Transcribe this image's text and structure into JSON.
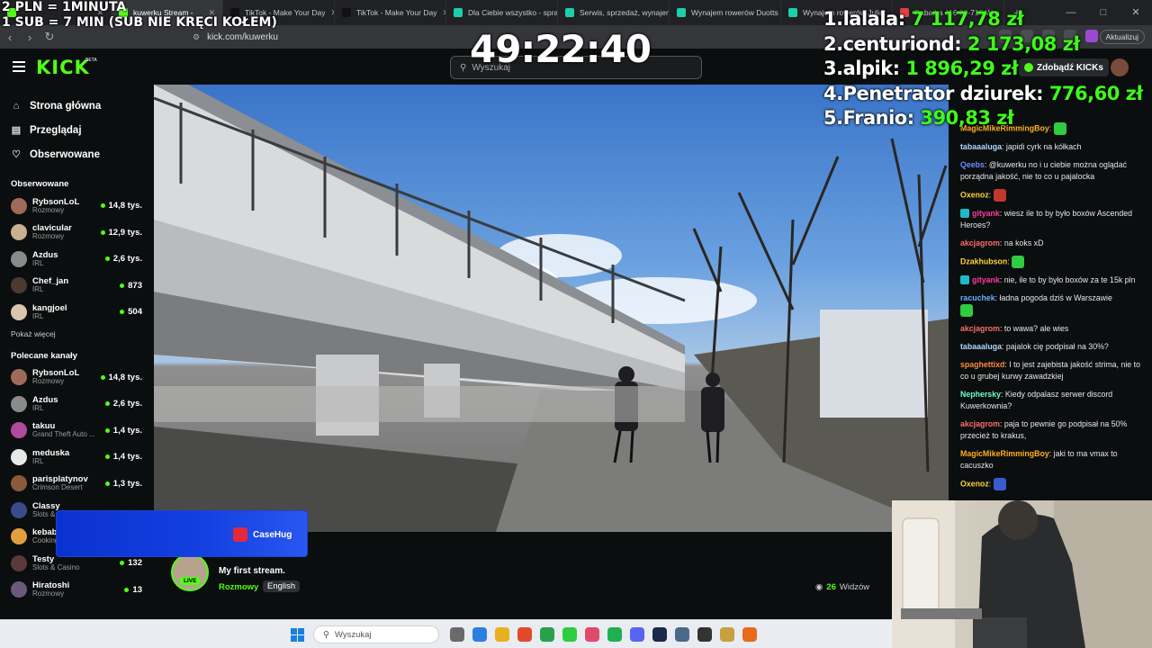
{
  "browser": {
    "tabs": [
      {
        "label": "",
        "color": "#53fc18"
      },
      {
        "label": "kuwerku Stream - ",
        "color": "#53fc18",
        "active": true
      },
      {
        "label": "TikTok - Make Your Day",
        "color": "#111111"
      },
      {
        "label": "TikTok - Make Your Day",
        "color": "#111111"
      },
      {
        "label": "Dla Ciebie wszystko - spra",
        "color": "#1ccfa8"
      },
      {
        "label": "Serwis, sprzedaż, wynajem",
        "color": "#1ccfa8"
      },
      {
        "label": "Wynajem rowerów Duotts",
        "color": "#1ccfa8"
      },
      {
        "label": "Wynajem rowerów Juliet",
        "color": "#1ccfa8"
      },
      {
        "label": "Rabatka 116 00-715 War",
        "color": "#e04040"
      }
    ],
    "url": "kick.com/kuwerku",
    "update_label": "Aktualizuj"
  },
  "header": {
    "logo": "KICK",
    "beta": "BETA",
    "search_placeholder": "Wyszukaj",
    "get_kicks": "Zdobądź KICKs"
  },
  "sidebar": {
    "nav": [
      {
        "label": "Strona główna",
        "icon": "home-icon"
      },
      {
        "label": "Przeglądaj",
        "icon": "browse-icon"
      },
      {
        "label": "Obserwowane",
        "icon": "heart-icon"
      }
    ],
    "followed_title": "Obserwowane",
    "followed": [
      {
        "name": "RybsonLoL",
        "category": "Rozmowy",
        "viewers": "14,8 tys.",
        "color": "#a06a5a"
      },
      {
        "name": "clavicular",
        "category": "Rozmowy",
        "viewers": "12,9 tys.",
        "color": "#c8b090"
      },
      {
        "name": "Azdus",
        "category": "IRL",
        "viewers": "2,6 tys.",
        "color": "#8a8a8a"
      },
      {
        "name": "Chef_jan",
        "category": "IRL",
        "viewers": "873",
        "color": "#4a3a30"
      },
      {
        "name": "kangjoel",
        "category": "IRL",
        "viewers": "504",
        "color": "#d9c4b0"
      }
    ],
    "show_more": "Pokaż więcej",
    "recommended_title": "Polecane kanały",
    "recommended": [
      {
        "name": "RybsonLoL",
        "category": "Rozmowy",
        "viewers": "14,8 tys.",
        "color": "#a06a5a"
      },
      {
        "name": "Azdus",
        "category": "IRL",
        "viewers": "2,6 tys.",
        "color": "#8a8a8a"
      },
      {
        "name": "takuu",
        "category": "Grand Theft Auto ...",
        "viewers": "1,4 tys.",
        "color": "#b04a9a"
      },
      {
        "name": "meduska",
        "category": "IRL",
        "viewers": "1,4 tys.",
        "color": "#e8e8e8"
      },
      {
        "name": "parisplatynov",
        "category": "Crimson Desert",
        "viewers": "1,3 tys.",
        "color": "#8a5a3a"
      },
      {
        "name": "Classy",
        "category": "Slots & ...",
        "viewers": "",
        "color": "#3a4a8a"
      },
      {
        "name": "kebab",
        "category": "Cooking",
        "viewers": "",
        "color": "#e0a040"
      },
      {
        "name": "Testy",
        "category": "Slots & Casino",
        "viewers": "132",
        "color": "#5a3a3a"
      },
      {
        "name": "Hiratoshi",
        "category": "Rozmowy",
        "viewers": "13",
        "color": "#6a5a7a"
      }
    ]
  },
  "stream": {
    "title": "My first stream.",
    "category": "Rozmowy",
    "language": "English",
    "live": "LIVE",
    "viewers_count": "26",
    "viewers_label": "Widzów"
  },
  "chat": [
    {
      "user": "MagicMikeRimmingBoy",
      "color": "#ffb020",
      "text": "",
      "emote": "#2ecc40"
    },
    {
      "user": "tabaaaluga",
      "color": "#b0d8ff",
      "text": "japidi cyrk na kółkach"
    },
    {
      "user": "Qeebs",
      "color": "#6a8cff",
      "text": "@kuwerku no i u ciebie można oglądać porządna jakość, nie to co u pajalocka"
    },
    {
      "user": "Oxenoz",
      "color": "#ffd23a",
      "text": "",
      "emote": "#c0392b"
    },
    {
      "user": "gityank",
      "color": "#ff3aa0",
      "text": "wiesz ile to by było boxów Ascended Heroes?",
      "badge": true
    },
    {
      "user": "akcjagrom",
      "color": "#ff6a6a",
      "text": "na koks xD"
    },
    {
      "user": "Dzakhubson",
      "color": "#ffd23a",
      "text": "",
      "emote": "#2ecc40"
    },
    {
      "user": "gityank",
      "color": "#ff3aa0",
      "text": "nie, ile to by było boxów za te 15k pln",
      "badge": true
    },
    {
      "user": "racuchek",
      "color": "#6ab0ff",
      "text": "ładna pogoda dziś w Warszawie",
      "emote_after": "#2ecc40"
    },
    {
      "user": "akcjagrom",
      "color": "#ff6a6a",
      "text": "to wawa? ale wies"
    },
    {
      "user": "tabaaaluga",
      "color": "#b0d8ff",
      "text": "pajalok cię podpisał na 30%?"
    },
    {
      "user": "spaghettixd",
      "color": "#ff8a3a",
      "text": "I to jest zajebista jakość strima, nie to co u grubej kurwy zawadzkiej"
    },
    {
      "user": "Nephersky",
      "color": "#6affc8",
      "text": "Kiedy odpalasz serwer discord Kuwerkownia?"
    },
    {
      "user": "akcjagrom",
      "color": "#ff6a6a",
      "text": "paja to pewnie go podpisał na 50% przecież to krakus,"
    },
    {
      "user": "MagicMikeRimmingBoy",
      "color": "#ffb020",
      "text": "jaki to ma vmax to cacuszko"
    },
    {
      "user": "Oxenoz",
      "color": "#ffd23a",
      "text": "",
      "emote": "#3a5ad0"
    }
  ],
  "overlays": {
    "line1": "2 PLN = 1MINUTA",
    "line2": "1 SUB = 7 MIN (SUB NIE KRĘCI KOŁEM)",
    "timer": "49:22:40",
    "leaderboard": [
      {
        "rank": "1.",
        "name": "lalala:",
        "amount": "7 117,78 zł"
      },
      {
        "rank": "2.",
        "name": "centuriond:",
        "amount": "2 173,08 zł"
      },
      {
        "rank": "3.",
        "name": "alpik:",
        "amount": "1 896,29 zł"
      },
      {
        "rank": "4.",
        "name": "Penetrator dziurek:",
        "amount": "776,60 zł"
      },
      {
        "rank": "5.",
        "name": "Franio:",
        "amount": "390,83 zł"
      }
    ],
    "sponsor": "CaseHug"
  },
  "taskbar": {
    "search_placeholder": "Wyszukaj",
    "icons": [
      "#6a6a6a",
      "#2a7fe0",
      "#e8b020",
      "#e04a2a",
      "#2aa04a",
      "#2ecc40",
      "#e04a6a",
      "#20b050",
      "#5865f2",
      "#1a2a4a",
      "#4a6a8a",
      "#333333",
      "#c8a040",
      "#e86a1a"
    ]
  }
}
